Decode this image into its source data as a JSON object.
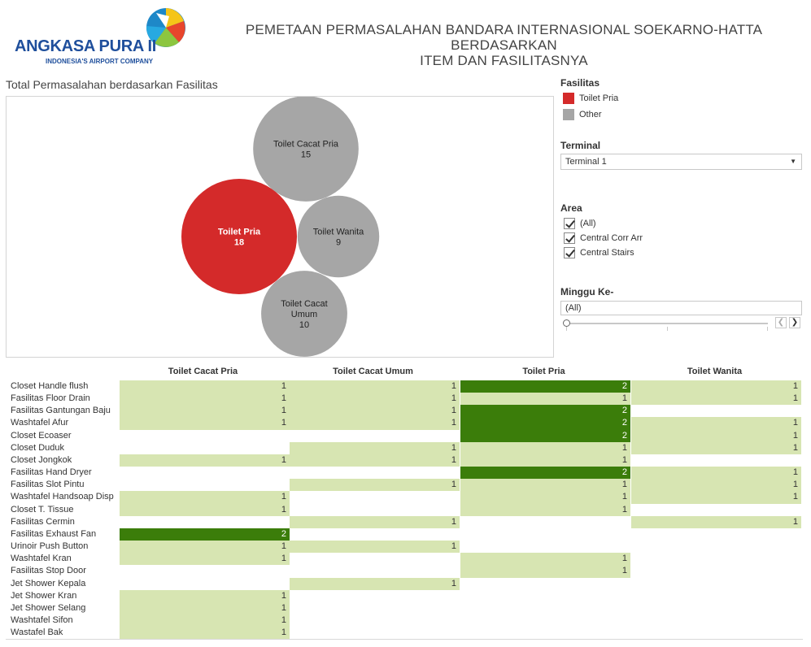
{
  "header": {
    "logo_name": "ANGKASA PURA II",
    "logo_tagline": "INDONESIA'S AIRPORT COMPANY",
    "title_line1": "PEMETAAN PERMASALAHAN BANDARA INTERNASIONAL SOEKARNO-HATTA BERDASARKAN",
    "title_line2": "ITEM DAN FASILITASNYA"
  },
  "bubble_section": {
    "title": "Total Permasalahan berdasarkan Fasilitas"
  },
  "filters": {
    "legend_heading": "Fasilitas",
    "legend": [
      {
        "label": "Toilet Pria",
        "color": "#d42a2a"
      },
      {
        "label": "Other",
        "color": "#a6a6a6"
      }
    ],
    "terminal_heading": "Terminal",
    "terminal_value": "Terminal 1",
    "area_heading": "Area",
    "area_options": [
      {
        "label": "(All)",
        "checked": true
      },
      {
        "label": "Central Corr Arr",
        "checked": true
      },
      {
        "label": "Central Stairs",
        "checked": true
      }
    ],
    "week_heading": "Minggu Ke-",
    "week_value": "(All)"
  },
  "colors": {
    "highlight": "#d42a2a",
    "other": "#a6a6a6",
    "cell_low": "#d7e5b2",
    "cell_high": "#3b7d0a"
  },
  "chart_data": [
    {
      "type": "bubble",
      "title": "Total Permasalahan berdasarkan Fasilitas",
      "categories": [
        "Toilet Cacat Pria",
        "Toilet Pria",
        "Toilet Wanita",
        "Toilet Cacat Umum"
      ],
      "labels": [
        [
          "Toilet Cacat Pria"
        ],
        [
          "Toilet Pria"
        ],
        [
          "Toilet Wanita"
        ],
        [
          "Toilet Cacat",
          "Umum"
        ]
      ],
      "values": [
        15,
        18,
        9,
        10
      ],
      "colors": [
        "#a6a6a6",
        "#d42a2a",
        "#a6a6a6",
        "#a6a6a6"
      ]
    },
    {
      "type": "heatmap",
      "columns": [
        "Toilet Cacat Pria",
        "Toilet Cacat Umum",
        "Toilet Pria",
        "Toilet Wanita"
      ],
      "rows": [
        {
          "label": "Closet Handle flush",
          "values": [
            1,
            1,
            2,
            1
          ]
        },
        {
          "label": "Fasilitas Floor Drain",
          "values": [
            1,
            1,
            1,
            1
          ]
        },
        {
          "label": "Fasilitas Gantungan Baju",
          "values": [
            1,
            1,
            2,
            null
          ]
        },
        {
          "label": "Washtafel Afur",
          "values": [
            1,
            1,
            2,
            1
          ]
        },
        {
          "label": "Closet  Ecoaser",
          "values": [
            null,
            null,
            2,
            1
          ]
        },
        {
          "label": "Closet Duduk",
          "values": [
            null,
            1,
            1,
            1
          ]
        },
        {
          "label": "Closet Jongkok",
          "values": [
            1,
            1,
            1,
            null
          ]
        },
        {
          "label": "Fasilitas Hand Dryer",
          "values": [
            null,
            null,
            2,
            1
          ]
        },
        {
          "label": "Fasilitas Slot Pintu",
          "values": [
            null,
            1,
            1,
            1
          ]
        },
        {
          "label": "Washtafel Handsoap Disp",
          "values": [
            1,
            null,
            1,
            1
          ]
        },
        {
          "label": "Closet T. Tissue",
          "values": [
            1,
            null,
            1,
            null
          ]
        },
        {
          "label": "Fasilitas Cermin",
          "values": [
            null,
            1,
            null,
            1
          ]
        },
        {
          "label": "Fasilitas Exhaust Fan",
          "values": [
            2,
            null,
            null,
            null
          ]
        },
        {
          "label": "Urinoir Push Button",
          "values": [
            1,
            1,
            null,
            null
          ]
        },
        {
          "label": "Washtafel Kran",
          "values": [
            1,
            null,
            1,
            null
          ]
        },
        {
          "label": "Fasilitas Stop Door",
          "values": [
            null,
            null,
            1,
            null
          ]
        },
        {
          "label": "Jet Shower Kepala",
          "values": [
            null,
            1,
            null,
            null
          ]
        },
        {
          "label": "Jet Shower Kran",
          "values": [
            1,
            null,
            null,
            null
          ]
        },
        {
          "label": "Jet Shower Selang",
          "values": [
            1,
            null,
            null,
            null
          ]
        },
        {
          "label": "Washtafel Sifon",
          "values": [
            1,
            null,
            null,
            null
          ]
        },
        {
          "label": "Wastafel Bak",
          "values": [
            1,
            null,
            null,
            null
          ]
        }
      ]
    }
  ]
}
